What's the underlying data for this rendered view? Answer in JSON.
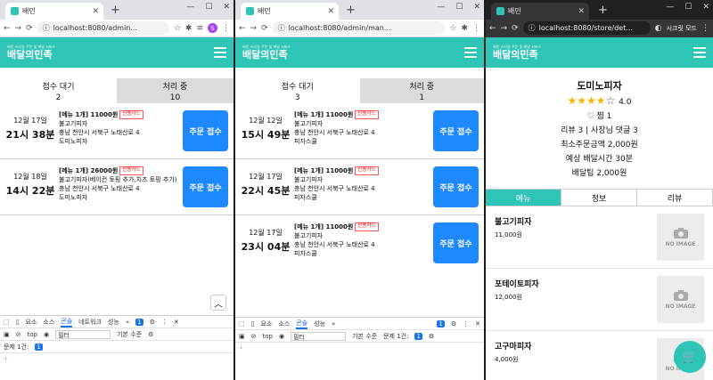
{
  "windows": {
    "w1": {
      "tab_title": "배민",
      "url": "localhost:8080/admin...",
      "profile_letter": "S",
      "logo_sub": "배민 스타일 주문 및 배달 서비스",
      "logo": "배달의민족",
      "tabs": [
        {
          "label": "접수 대기",
          "count": "2"
        },
        {
          "label": "처리 중",
          "count": "10"
        }
      ],
      "orders": [
        {
          "date": "12월 17일",
          "time": "21시 38분",
          "menu": "[메뉴 1개] 11000원",
          "pay": "신용카드",
          "detail": "불고기피자",
          "address": "충남 천안시 서북구 노태산로 4",
          "store": "도미노피자",
          "button": "주문 접수"
        },
        {
          "date": "12월 18일",
          "time": "14시 22분",
          "menu": "[메뉴 1개] 26000원",
          "pay": "신용카드",
          "detail": "불고기피자(베이컨 토핑 추가,치즈 토핑 추가)",
          "address": "충남 천안시 서북구 노태산로 4",
          "store": "도미노피자",
          "button": "주문 접수"
        }
      ],
      "devtools": {
        "tabs": [
          "요소",
          "소스",
          "콘솔",
          "네트워크",
          "성능",
          "»"
        ],
        "active": "콘솔",
        "badge": "1",
        "top": "top",
        "filter_placeholder": "필터",
        "level": "기본 수준",
        "issues": "문제 1건:",
        "issue_count": "1"
      }
    },
    "w2": {
      "tab_title": "배민",
      "url": "localhost:8080/admin/man...",
      "logo_sub": "배민 스타일 주문 및 배달 서비스",
      "logo": "배달의민족",
      "tabs": [
        {
          "label": "접수 대기",
          "count": "3"
        },
        {
          "label": "처리 중",
          "count": "1"
        }
      ],
      "orders": [
        {
          "date": "12월 12일",
          "time": "15시 49분",
          "menu": "[메뉴 1개] 11000원",
          "pay": "신용카드",
          "detail": "불고기피자",
          "address": "충남 천안시 서북구 노태산로 4",
          "store": "피자스쿨",
          "button": "주문 접수"
        },
        {
          "date": "12월 17일",
          "time": "22시 45분",
          "menu": "[메뉴 1개] 11000원",
          "pay": "신용카드",
          "detail": "불고기피자",
          "address": "충남 천안시 서북구 노태산로 4",
          "store": "피자스쿨",
          "button": "주문 접수"
        },
        {
          "date": "12월 17일",
          "time": "23시 04분",
          "menu": "[메뉴 1개] 11000원",
          "pay": "신용카드",
          "detail": "불고기피자",
          "address": "충남 천안시 서북구 노태산로 4",
          "store": "피자스쿨",
          "button": "주문 접수"
        }
      ],
      "devtools": {
        "tabs": [
          "요소",
          "소스",
          "콘솔",
          "성능",
          "»"
        ],
        "active": "콘솔",
        "badge": "1",
        "top": "top",
        "filter_placeholder": "필터",
        "level": "기본 수준",
        "issues": "문제 1건:",
        "issue_count": "1"
      }
    },
    "w3": {
      "tab_title": "배민",
      "url": "localhost:8080/store/det...",
      "secret": "시크릿 모드",
      "logo_sub": "배민 스타일 주문 및 배달 서비스",
      "logo": "배달의민족",
      "store": {
        "name": "도미노피자",
        "rating": "4.0",
        "stars_filled": 4,
        "likes": "찜 1",
        "reviews": "리뷰 3 | 사장님 댓글 3",
        "min_order": "최소주문금액 2,000원",
        "delivery_time": "예상 배달시간 30분",
        "tip": "배달팁 2,000원"
      },
      "tabs": [
        "메뉴",
        "정보",
        "리뷰"
      ],
      "menu": [
        {
          "name": "불고기피자",
          "price": "11,000원",
          "img": "NO IMAGE"
        },
        {
          "name": "포테이토피자",
          "price": "12,000원",
          "img": "NO IMAGE"
        },
        {
          "name": "고구마피자",
          "price": "4,000원",
          "img": "NO IMAGE"
        }
      ]
    }
  },
  "colors": {
    "brand": "#2ec4b6",
    "accept": "#1e88ff"
  }
}
